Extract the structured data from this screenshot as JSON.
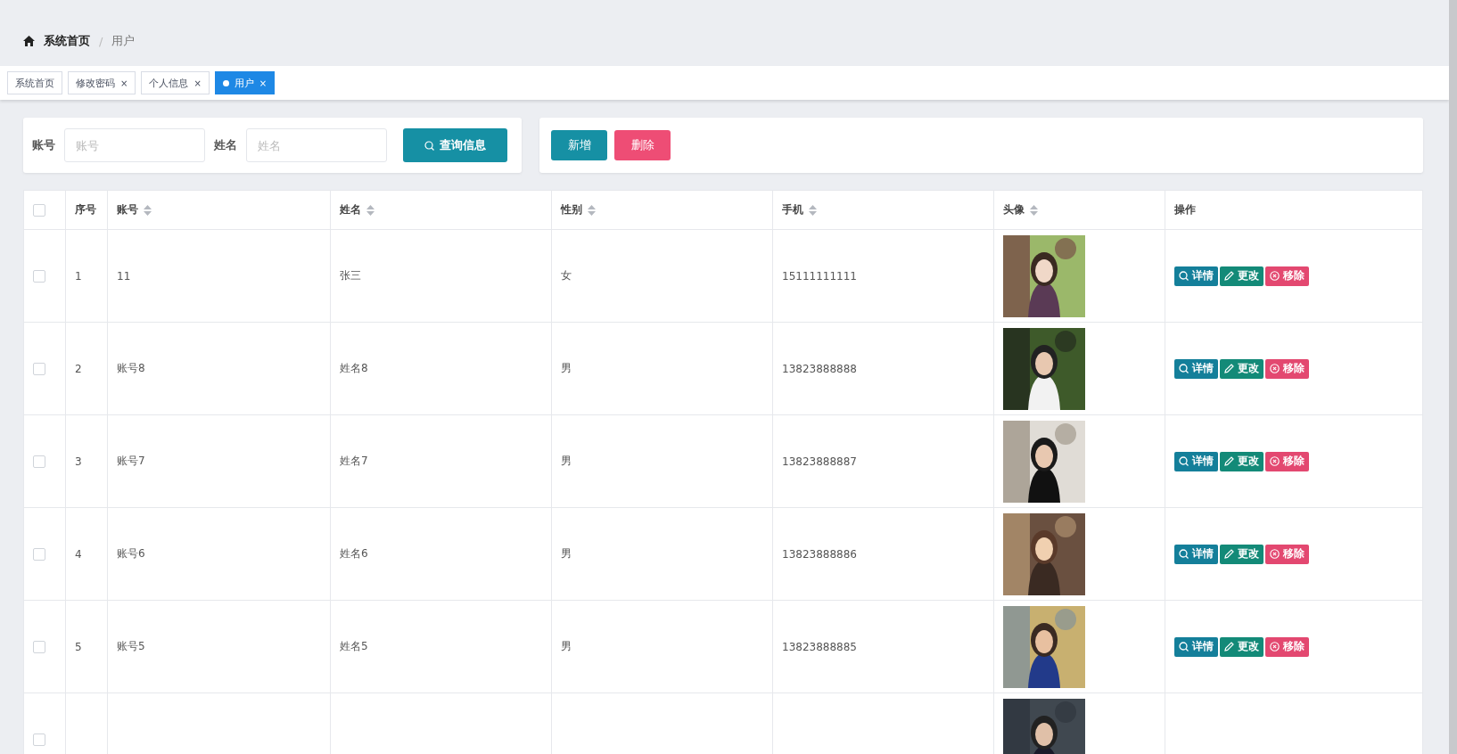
{
  "breadcrumb": {
    "home": "系统首页",
    "separator": "/",
    "current": "用户"
  },
  "tabs": [
    {
      "label": "系统首页",
      "selected": false,
      "closable": false
    },
    {
      "label": "修改密码",
      "selected": false,
      "closable": true
    },
    {
      "label": "个人信息",
      "selected": false,
      "closable": true
    },
    {
      "label": "用户",
      "selected": true,
      "closable": true
    }
  ],
  "close_glyph": "×",
  "search": {
    "fields": [
      {
        "label": "账号",
        "placeholder": "账号"
      },
      {
        "label": "姓名",
        "placeholder": "姓名"
      }
    ],
    "button": "查询信息"
  },
  "actions": [
    {
      "label": "新增",
      "kind": "primary"
    },
    {
      "label": "删除",
      "kind": "danger"
    }
  ],
  "table": {
    "select_all": {
      "checked": false
    },
    "columns": [
      {
        "label": "序号",
        "sortable": false
      },
      {
        "label": "账号",
        "sortable": true
      },
      {
        "label": "姓名",
        "sortable": true
      },
      {
        "label": "性别",
        "sortable": true
      },
      {
        "label": "手机",
        "sortable": true
      },
      {
        "label": "头像",
        "sortable": true
      },
      {
        "label": "操作",
        "sortable": false
      }
    ],
    "rows": [
      {
        "checked": false,
        "index": "1",
        "account": "11",
        "name": "张三",
        "gender": "女",
        "phone": "15111111111",
        "avatar": {
          "kind": "picture"
        },
        "buttons": [
          {
            "label": "详情",
            "kind": "detail"
          },
          {
            "label": "更改",
            "kind": "edit"
          },
          {
            "label": "移除",
            "kind": "remove"
          }
        ]
      },
      {
        "checked": false,
        "index": "2",
        "account": "账号8",
        "name": "姓名8",
        "gender": "男",
        "phone": "13823888888",
        "avatar": {
          "kind": "picture"
        },
        "buttons": [
          {
            "label": "详情",
            "kind": "detail"
          },
          {
            "label": "更改",
            "kind": "edit"
          },
          {
            "label": "移除",
            "kind": "remove"
          }
        ]
      },
      {
        "checked": false,
        "index": "3",
        "account": "账号7",
        "name": "姓名7",
        "gender": "男",
        "phone": "13823888887",
        "avatar": {
          "kind": "picture"
        },
        "buttons": [
          {
            "label": "详情",
            "kind": "detail"
          },
          {
            "label": "更改",
            "kind": "edit"
          },
          {
            "label": "移除",
            "kind": "remove"
          }
        ]
      },
      {
        "checked": false,
        "index": "4",
        "account": "账号6",
        "name": "姓名6",
        "gender": "男",
        "phone": "13823888886",
        "avatar": {
          "kind": "picture"
        },
        "buttons": [
          {
            "label": "详情",
            "kind": "detail"
          },
          {
            "label": "更改",
            "kind": "edit"
          },
          {
            "label": "移除",
            "kind": "remove"
          }
        ]
      },
      {
        "checked": false,
        "index": "5",
        "account": "账号5",
        "name": "姓名5",
        "gender": "男",
        "phone": "13823888885",
        "avatar": {
          "kind": "picture"
        },
        "buttons": [
          {
            "label": "详情",
            "kind": "detail"
          },
          {
            "label": "更改",
            "kind": "edit"
          },
          {
            "label": "移除",
            "kind": "remove"
          }
        ]
      },
      {
        "checked": false,
        "avatar": {
          "kind": "picture"
        }
      }
    ]
  }
}
